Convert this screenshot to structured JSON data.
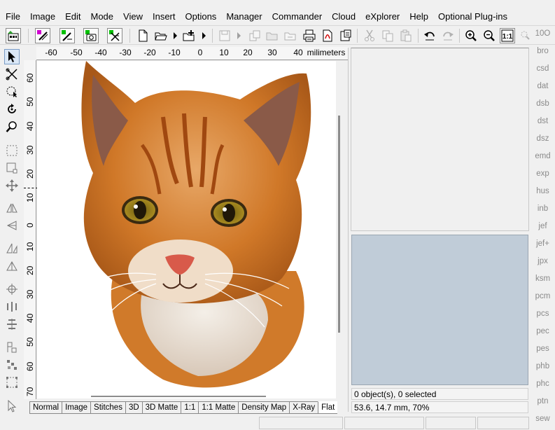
{
  "menu": [
    "File",
    "Image",
    "Edit",
    "Mode",
    "View",
    "Insert",
    "Options",
    "Manager",
    "Commander",
    "Cloud",
    "eXplorer",
    "Help",
    "Optional Plug-ins"
  ],
  "toolbar_icons": [
    "browse-icon",
    "brush-icon",
    "magic-wand-icon",
    "camera-icon",
    "scissors-icon",
    "new-document-icon",
    "open-folder-icon",
    "insert-icon",
    "save-icon",
    "copy-to-icon",
    "move-to-icon",
    "print-icon",
    "pdf-icon",
    "export-icon",
    "cut-icon",
    "copy-icon",
    "paste-icon",
    "undo-icon",
    "redo-icon",
    "zoom-in-icon",
    "zoom-out-icon",
    "actual-size-icon",
    "fit-icon"
  ],
  "left_tools": [
    "select-arrow-icon",
    "lasso-icon",
    "freehand-select-icon",
    "rotate-icon",
    "magnifier-icon",
    "rect-select-icon",
    "crop-icon",
    "move-icon",
    "flip-vertical-icon",
    "flip-horizontal-icon",
    "skew-icon",
    "perspective-icon",
    "center-icon",
    "distribute-h-icon",
    "distribute-v-icon",
    "align-icon",
    "scatter-icon",
    "frame-icon",
    "pointer-icon"
  ],
  "ruler": {
    "unit": "milimeters",
    "h_ticks": [
      "-60",
      "-50",
      "-40",
      "-30",
      "-20",
      "-10",
      "0",
      "10",
      "20",
      "30",
      "40"
    ],
    "v_ticks": [
      "60",
      "50",
      "40",
      "30",
      "20",
      "10",
      "0",
      "10",
      "20",
      "30",
      "40",
      "50",
      "60",
      "70"
    ]
  },
  "tabs": [
    "Normal",
    "Image",
    "Stitches",
    "3D",
    "3D Matte",
    "1:1",
    "1:1 Matte",
    "Density Map",
    "X-Ray",
    "Flat"
  ],
  "active_tab": "Flat",
  "info": {
    "selection": "0 object(s), 0 selected",
    "position": "53.6, 14.7 mm, 70%"
  },
  "formats": [
    "10O",
    "bro",
    "csd",
    "dat",
    "dsb",
    "dst",
    "dsz",
    "emd",
    "exp",
    "hus",
    "inb",
    "jef",
    "jef+",
    "jpx",
    "ksm",
    "pcm",
    "pcs",
    "pec",
    "pes",
    "phb",
    "phc",
    "ptn",
    "sew"
  ],
  "colors": {
    "preview_bg": "#c0ccd8",
    "canvas_bg": "#ffffff",
    "format_text": "#8a8a8a"
  }
}
